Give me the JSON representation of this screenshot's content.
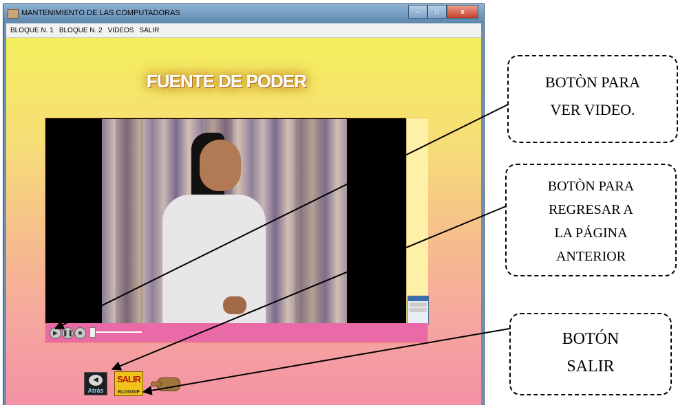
{
  "window": {
    "title": "MANTENIMIENTO DE LAS COMPUTADORAS",
    "controls": {
      "minimize": "–",
      "maximize": "□",
      "close": "x"
    }
  },
  "menu": {
    "items": [
      "BLOQUE N. 1",
      "BLOQUE N. 2",
      "VIDEOS",
      "SALIR"
    ]
  },
  "page": {
    "heading": "FUENTE DE PODER"
  },
  "player": {
    "play_glyph": "▶",
    "pause_glyph": "❚❚",
    "stop_glyph": "■",
    "progress": 0.0
  },
  "buttons": {
    "atras_label": "Atrás",
    "salir_label": "SALIR",
    "salir_sub": "BLOGGIF"
  },
  "callouts": {
    "video": [
      "BOTÒN PARA",
      "VER VIDEO."
    ],
    "back": [
      "BOTÒN PARA",
      "REGRESAR A",
      "LA PÁGINA",
      "ANTERIOR"
    ],
    "exit": [
      "BOTÓN",
      "SALIR"
    ]
  },
  "colors": {
    "controls_bar": "#ea6aa8",
    "heading_glow": "#c98a2d"
  }
}
